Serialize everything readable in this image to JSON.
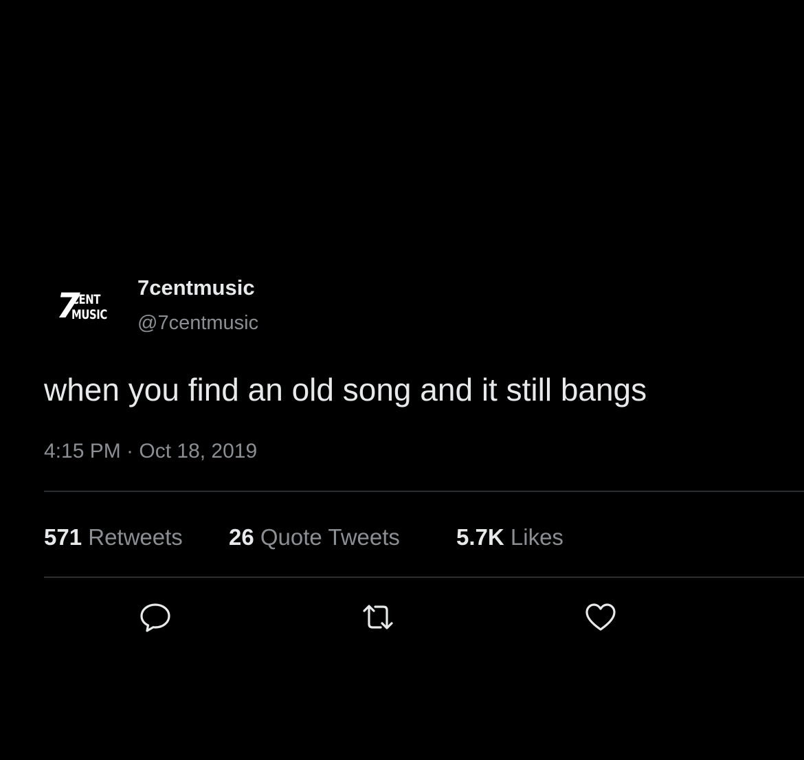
{
  "tweet": {
    "avatar": {
      "line1_big": "7",
      "line1_small": "CENT",
      "line2_small": "MUSIC"
    },
    "display_name": "7centmusic",
    "handle": "@7centmusic",
    "text": "when you find an old song and it still bangs",
    "timestamp": "4:15 PM · Oct 18, 2019",
    "stats": {
      "retweets": {
        "count": "571",
        "label": "Retweets"
      },
      "quotes": {
        "count": "26",
        "label": "Quote Tweets"
      },
      "likes": {
        "count": "5.7K",
        "label": "Likes"
      }
    },
    "actions": [
      {
        "name": "reply",
        "icon": "speech-bubble-icon"
      },
      {
        "name": "retweet",
        "icon": "retweet-arrows-icon"
      },
      {
        "name": "like",
        "icon": "heart-outline-icon"
      }
    ]
  },
  "colors": {
    "background": "#000000",
    "primary_text": "#e7e9ea",
    "secondary_text": "#8b8f93",
    "divider": "#2b2e31"
  }
}
